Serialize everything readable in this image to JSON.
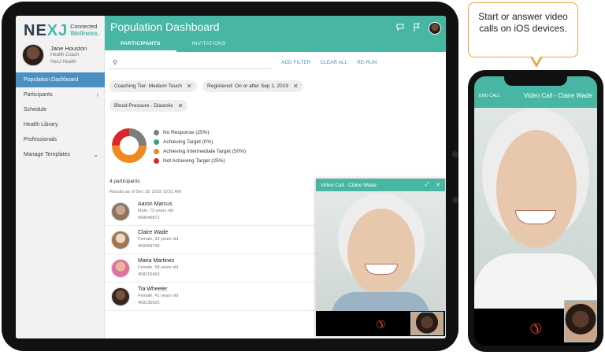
{
  "app": {
    "logo_mark_1": "NE",
    "logo_mark_2": "XJ",
    "logo_line1": "Connected",
    "logo_line2": "Wellness."
  },
  "user": {
    "name": "Jane Houston",
    "role": "Health Coach",
    "org": "NexJ Health"
  },
  "sidebar": {
    "items": [
      {
        "label": "Population Dashboard",
        "active": true
      },
      {
        "label": "Participants",
        "chevron": "›"
      },
      {
        "label": "Schedule"
      },
      {
        "label": "Health Library"
      },
      {
        "label": "Professionals"
      },
      {
        "label": "Manage Templates",
        "chevron": "⌄"
      }
    ]
  },
  "header": {
    "title": "Population Dashboard",
    "tabs": [
      {
        "label": "PARTICIPANTS",
        "active": true
      },
      {
        "label": "INVITATIONS"
      }
    ],
    "icons": [
      "chat-icon",
      "flag-icon",
      "avatar"
    ]
  },
  "toolbar": {
    "search_icon": "⚲",
    "add_filter": "ADD FILTER",
    "clear_all": "CLEAR ALL",
    "rerun": "RE-RUN"
  },
  "filters": [
    {
      "label": "Coaching Tier: Medium Touch"
    },
    {
      "label": "Registered: On or after Sep 1, 2019"
    },
    {
      "label": "Blood Pressure - Diastolic"
    }
  ],
  "chart_data": {
    "type": "pie",
    "categories": [
      "No Response",
      "Achieving Target",
      "Achieving Intermediate Target",
      "Not Achieving Target"
    ],
    "values": [
      25,
      0,
      50,
      25
    ],
    "legend_labels": [
      "No Response (25%)",
      "Achieving Target (0%)",
      "Achieving Intermediate Target (50%)",
      "Not Achieving Target (25%)"
    ],
    "colors": [
      "#7d7d7d",
      "#3aa27a",
      "#ef8a23",
      "#d9262b"
    ]
  },
  "results": {
    "count": "4 participants",
    "as_of": "Results as of Dec 18, 2019 10:51 AM",
    "participants": [
      {
        "name": "Aaron Marcus",
        "sub": "Male, 73 years old",
        "id": "458645872"
      },
      {
        "name": "Claire Wade",
        "sub": "Female, 33 years old",
        "id": "458458745"
      },
      {
        "name": "Maria Martinez",
        "sub": "Female, 58 years old",
        "id": "458215463"
      },
      {
        "name": "Tia Wheeler",
        "sub": "Female, 41 years old",
        "id": "458135625"
      }
    ]
  },
  "video_popup": {
    "title": "Video Call - Claire Wade",
    "expand_icon": "⤢",
    "close_icon": "✕",
    "hangup_icon": "✆"
  },
  "phone": {
    "end_call": "END CALL",
    "title": "Video Call - Claire Wade",
    "hangup_icon": "✆"
  },
  "callout": {
    "text": "Start or answer video calls on iOS devices."
  }
}
